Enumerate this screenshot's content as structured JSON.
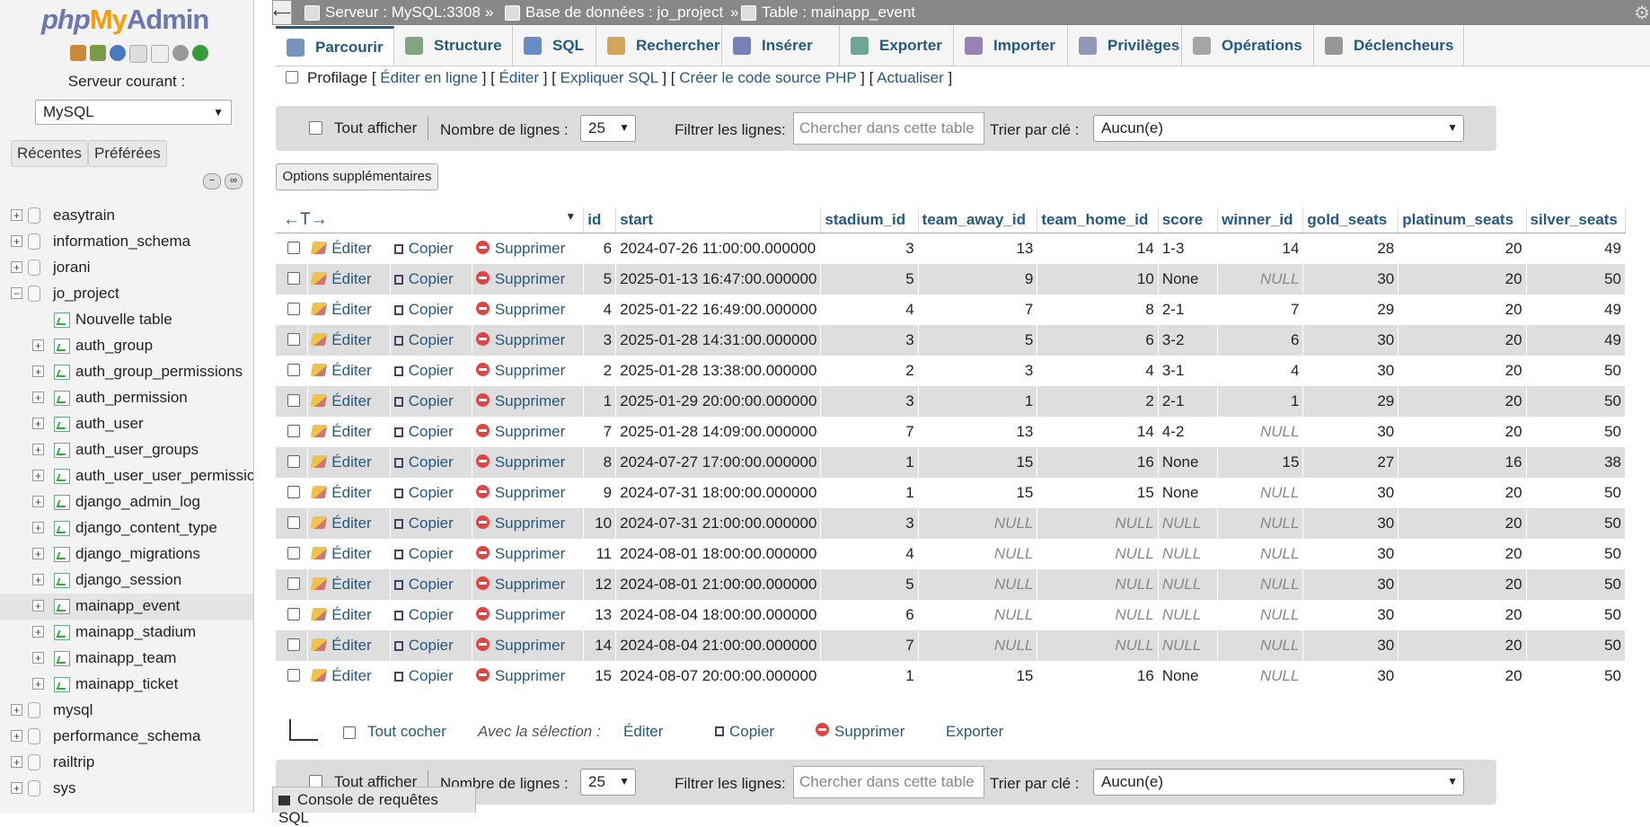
{
  "app": {
    "logo_php": "php",
    "logo_my": "My",
    "logo_admin": "Admin"
  },
  "sidebar": {
    "current_server_label": "Serveur courant :",
    "server_value": "MySQL",
    "btn_recent": "Récentes",
    "btn_favorites": "Préférées",
    "tree": [
      {
        "label": "easytrain",
        "level": 0,
        "kind": "db"
      },
      {
        "label": "information_schema",
        "level": 0,
        "kind": "db"
      },
      {
        "label": "jorani",
        "level": 0,
        "kind": "db"
      },
      {
        "label": "jo_project",
        "level": 0,
        "kind": "db-open"
      },
      {
        "label": "Nouvelle table",
        "level": 1,
        "kind": "new"
      },
      {
        "label": "auth_group",
        "level": 1,
        "kind": "table"
      },
      {
        "label": "auth_group_permissions",
        "level": 1,
        "kind": "table"
      },
      {
        "label": "auth_permission",
        "level": 1,
        "kind": "table"
      },
      {
        "label": "auth_user",
        "level": 1,
        "kind": "table"
      },
      {
        "label": "auth_user_groups",
        "level": 1,
        "kind": "table"
      },
      {
        "label": "auth_user_user_permissions",
        "level": 1,
        "kind": "table"
      },
      {
        "label": "django_admin_log",
        "level": 1,
        "kind": "table"
      },
      {
        "label": "django_content_type",
        "level": 1,
        "kind": "table"
      },
      {
        "label": "django_migrations",
        "level": 1,
        "kind": "table"
      },
      {
        "label": "django_session",
        "level": 1,
        "kind": "table"
      },
      {
        "label": "mainapp_event",
        "level": 1,
        "kind": "table",
        "selected": true
      },
      {
        "label": "mainapp_stadium",
        "level": 1,
        "kind": "table"
      },
      {
        "label": "mainapp_team",
        "level": 1,
        "kind": "table"
      },
      {
        "label": "mainapp_ticket",
        "level": 1,
        "kind": "table"
      },
      {
        "label": "mysql",
        "level": 0,
        "kind": "db"
      },
      {
        "label": "performance_schema",
        "level": 0,
        "kind": "db"
      },
      {
        "label": "railtrip",
        "level": 0,
        "kind": "db"
      },
      {
        "label": "sys",
        "level": 0,
        "kind": "db"
      }
    ]
  },
  "breadcrumb": {
    "server": "Serveur : MySQL:3308",
    "database": "Base de données : jo_project",
    "table": "Table : mainapp_event",
    "sep": "»"
  },
  "tabs": [
    {
      "label": "Parcourir",
      "active": true,
      "color": "#4a6fa5"
    },
    {
      "label": "Structure",
      "color": "#5a8a5a"
    },
    {
      "label": "SQL",
      "color": "#3a6ab0"
    },
    {
      "label": "Rechercher",
      "color": "#c68a2a"
    },
    {
      "label": "Insérer",
      "color": "#4b5aa0"
    },
    {
      "label": "Exporter",
      "color": "#3f8a7a"
    },
    {
      "label": "Importer",
      "color": "#7a5aa0"
    },
    {
      "label": "Privilèges",
      "color": "#6a7aa0"
    },
    {
      "label": "Opérations",
      "color": "#888888"
    },
    {
      "label": "Déclencheurs",
      "color": "#777777"
    }
  ],
  "profiling": {
    "label": "Profilage",
    "links": [
      "Éditer en ligne",
      "Éditer",
      "Expliquer SQL",
      "Créer le code source PHP",
      "Actualiser"
    ]
  },
  "nav": {
    "show_all": "Tout afficher",
    "rows_label": "Nombre de lignes :",
    "rows_value": "25",
    "filter_label": "Filtrer les lignes:",
    "filter_placeholder": "Chercher dans cette table",
    "sort_label": "Trier par clé :",
    "sort_value": "Aucun(e)"
  },
  "options_button": "Options supplémentaires",
  "table": {
    "sort_arrows": "←T→",
    "columns": [
      "id",
      "start",
      "stadium_id",
      "team_away_id",
      "team_home_id",
      "score",
      "winner_id",
      "gold_seats",
      "platinum_seats",
      "silver_seats"
    ],
    "actions": {
      "edit": "Éditer",
      "copy": "Copier",
      "delete": "Supprimer"
    },
    "rows": [
      [
        "6",
        "2024-07-26 11:00:00.000000",
        "3",
        "13",
        "14",
        "1-3",
        "14",
        "28",
        "20",
        "49"
      ],
      [
        "5",
        "2025-01-13 16:47:00.000000",
        "5",
        "9",
        "10",
        "None",
        "NULL",
        "30",
        "20",
        "50"
      ],
      [
        "4",
        "2025-01-22 16:49:00.000000",
        "4",
        "7",
        "8",
        "2-1",
        "7",
        "29",
        "20",
        "49"
      ],
      [
        "3",
        "2025-01-28 14:31:00.000000",
        "3",
        "5",
        "6",
        "3-2",
        "6",
        "30",
        "20",
        "49"
      ],
      [
        "2",
        "2025-01-28 13:38:00.000000",
        "2",
        "3",
        "4",
        "3-1",
        "4",
        "30",
        "20",
        "50"
      ],
      [
        "1",
        "2025-01-29 20:00:00.000000",
        "3",
        "1",
        "2",
        "2-1",
        "1",
        "29",
        "20",
        "50"
      ],
      [
        "7",
        "2025-01-28 14:09:00.000000",
        "7",
        "13",
        "14",
        "4-2",
        "NULL",
        "30",
        "20",
        "50"
      ],
      [
        "8",
        "2024-07-27 17:00:00.000000",
        "1",
        "15",
        "16",
        "None",
        "15",
        "27",
        "16",
        "38"
      ],
      [
        "9",
        "2024-07-31 18:00:00.000000",
        "1",
        "15",
        "15",
        "None",
        "NULL",
        "30",
        "20",
        "50"
      ],
      [
        "10",
        "2024-07-31 21:00:00.000000",
        "3",
        "NULL",
        "NULL",
        "NULL",
        "NULL",
        "30",
        "20",
        "50"
      ],
      [
        "11",
        "2024-08-01 18:00:00.000000",
        "4",
        "NULL",
        "NULL",
        "NULL",
        "NULL",
        "30",
        "20",
        "50"
      ],
      [
        "12",
        "2024-08-01 21:00:00.000000",
        "5",
        "NULL",
        "NULL",
        "NULL",
        "NULL",
        "30",
        "20",
        "50"
      ],
      [
        "13",
        "2024-08-04 18:00:00.000000",
        "6",
        "NULL",
        "NULL",
        "NULL",
        "NULL",
        "30",
        "20",
        "50"
      ],
      [
        "14",
        "2024-08-04 21:00:00.000000",
        "7",
        "NULL",
        "NULL",
        "NULL",
        "NULL",
        "30",
        "20",
        "50"
      ],
      [
        "15",
        "2024-08-07 20:00:00.000000",
        "1",
        "15",
        "16",
        "None",
        "NULL",
        "30",
        "20",
        "50"
      ]
    ]
  },
  "selection": {
    "check_all": "Tout cocher",
    "with_selection": "Avec la sélection :",
    "edit": "Éditer",
    "copy": "Copier",
    "delete": "Supprimer",
    "export": "Exporter"
  },
  "console": "Console de requêtes SQL"
}
